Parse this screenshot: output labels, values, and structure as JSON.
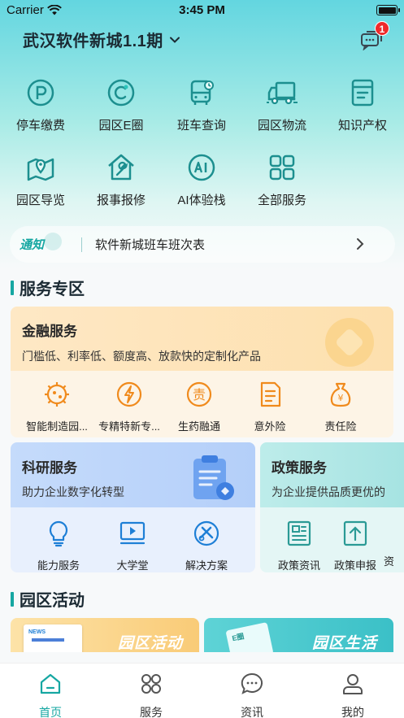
{
  "status_bar": {
    "carrier": "Carrier",
    "time": "3:45 PM"
  },
  "header": {
    "title": "武汉软件新城1.1期",
    "message_badge": "1"
  },
  "quick_services": [
    {
      "label": "停车缴费",
      "icon": "parking-icon"
    },
    {
      "label": "园区E圈",
      "icon": "e-circle-icon"
    },
    {
      "label": "班车查询",
      "icon": "bus-icon"
    },
    {
      "label": "园区物流",
      "icon": "truck-icon"
    },
    {
      "label": "知识产权",
      "icon": "book-icon"
    },
    {
      "label": "园区导览",
      "icon": "map-icon"
    },
    {
      "label": "报事报修",
      "icon": "repair-icon"
    },
    {
      "label": "AI体验栈",
      "icon": "ai-icon"
    },
    {
      "label": "全部服务",
      "icon": "all-services-icon"
    }
  ],
  "notice": {
    "tag": "通知",
    "text": "软件新城班车班次表"
  },
  "sections": {
    "services": "服务专区",
    "activities": "园区活动"
  },
  "finance": {
    "title": "金融服务",
    "subtitle": "门槛低、利率低、额度高、放款快的定制化产品",
    "items": [
      "智能制造园...",
      "专精特新专...",
      "生药融通",
      "意外险",
      "责任险"
    ]
  },
  "research": {
    "title": "科研服务",
    "subtitle": "助力企业数字化转型",
    "items": [
      "能力服务",
      "大学堂",
      "解决方案"
    ]
  },
  "policy": {
    "title": "政策服务",
    "subtitle": "为企业提供品质更优的",
    "items": [
      "政策资讯",
      "政策申报",
      "资"
    ]
  },
  "activities": [
    "园区活动",
    "园区生活"
  ],
  "tabbar": [
    {
      "label": "首页",
      "active": true
    },
    {
      "label": "服务",
      "active": false
    },
    {
      "label": "资讯",
      "active": false
    },
    {
      "label": "我的",
      "active": false
    }
  ],
  "colors": {
    "accent": "#16a7a2",
    "finance_icon": "#f08a1c",
    "research_icon": "#1e7fd6",
    "policy_icon": "#2a9a95"
  }
}
